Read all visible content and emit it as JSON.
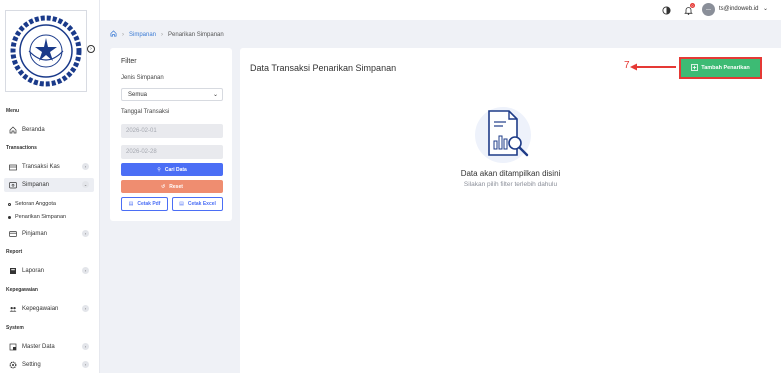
{
  "logo": {
    "text": "KOPERASI KKMB AL AZHAR HAMKA"
  },
  "sidebar": {
    "menu_label": "Menu",
    "beranda": "Beranda",
    "transactions_label": "Transactions",
    "transaksi_kas": "Transaksi Kas",
    "simpanan": "Simpanan",
    "setoran_anggota": "Setoran Anggota",
    "penarikan_simpanan": "Penarikan Simpanan",
    "pinjaman": "Pinjaman",
    "report_label": "Report",
    "laporan": "Laporan",
    "kepegawaian_label": "Kepegawaian",
    "kepegawaian": "Kepegawaian",
    "system_label": "System",
    "master_data": "Master Data",
    "setting": "Setting"
  },
  "topbar": {
    "notification_count": "0",
    "user_email": "ts@indoweb.id"
  },
  "breadcrumb": {
    "item1": "Simpanan",
    "item2": "Penarikan Simpanan"
  },
  "filter": {
    "title": "Filter",
    "jenis_label": "Jenis Simpanan",
    "jenis_value": "Semua",
    "tanggal_label": "Tanggal Transaksi",
    "date_from": "2026-02-01",
    "date_to": "2026-02-28",
    "cari_label": "Cari Data",
    "reset_label": "Reset",
    "pdf_label": "Cetak Pdf",
    "excel_label": "Cetak Excel"
  },
  "main": {
    "title": "Data Transaksi Penarikan Simpanan",
    "step_number": "7",
    "tambah_label": "Tambah Penarikan",
    "empty_title": "Data akan ditampilkan disini",
    "empty_subtitle": "Silakan pilih filter terlebih dahulu"
  },
  "colors": {
    "primary": "#4b6ef5",
    "reset": "#ef8d70",
    "success": "#3dbb74",
    "annotation": "#e53935"
  }
}
